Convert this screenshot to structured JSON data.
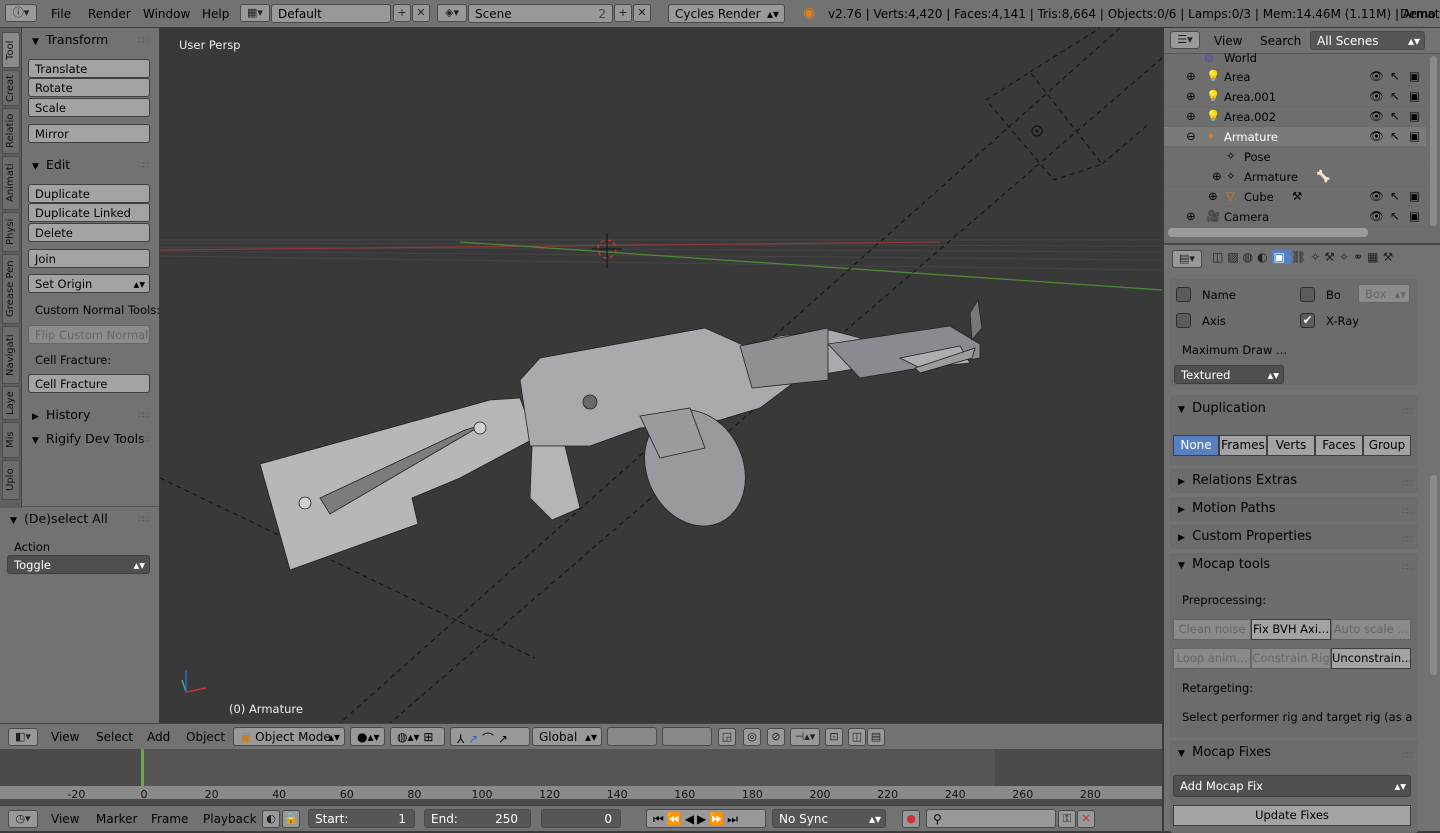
{
  "topbar": {
    "menus": [
      "File",
      "Render",
      "Window",
      "Help"
    ],
    "layout": "Default",
    "scene": "Scene",
    "scene_users": "2",
    "engine": "Cycles Render",
    "stats": "v2.76 | Verts:4,420 | Faces:4,141 | Tris:8,664 | Objects:0/6 | Lamps:0/3 | Mem:14.46M (1.11M) | Armature",
    "right_text": "Demo M"
  },
  "toolshelf": {
    "tabs": [
      "Tool",
      "Creat",
      "Relatio",
      "Animati",
      "Physi",
      "Grease Pen",
      "Navigati",
      "Laye",
      "Mis",
      "Uplo"
    ],
    "transform": {
      "title": "Transform",
      "buttons": [
        "Translate",
        "Rotate",
        "Scale"
      ],
      "mirror": "Mirror"
    },
    "edit": {
      "title": "Edit",
      "duplicate": "Duplicate",
      "duplicate_linked": "Duplicate Linked",
      "delete": "Delete",
      "join": "Join",
      "set_origin": "Set Origin",
      "custom_normal_label": "Custom Normal Tools:",
      "flip_normals": "Flip Custom Normals",
      "cell_fracture_label": "Cell Fracture:",
      "cell_fracture": "Cell Fracture"
    },
    "history": "History",
    "rigify": "Rigify Dev Tools",
    "operator": {
      "title": "(De)select All",
      "action_label": "Action",
      "action_value": "Toggle"
    }
  },
  "viewport": {
    "view_name": "User Persp",
    "object_label": "(0) Armature"
  },
  "viewhdr": {
    "menus": [
      "View",
      "Select",
      "Add",
      "Object"
    ],
    "mode": "Object Mode",
    "orientation": "Global"
  },
  "timeline": {
    "ticks": [
      "-20",
      "0",
      "20",
      "40",
      "60",
      "80",
      "100",
      "120",
      "140",
      "160",
      "180",
      "200",
      "220",
      "240",
      "260",
      "280"
    ],
    "current_frame": 0
  },
  "timehdr": {
    "menus": [
      "View",
      "Marker",
      "Frame",
      "Playback"
    ],
    "start_label": "Start:",
    "start_value": "1",
    "end_label": "End:",
    "end_value": "250",
    "frame_value": "0",
    "sync": "No Sync"
  },
  "outliner": {
    "menus": [
      "View",
      "Search"
    ],
    "scenes": "All Scenes",
    "rows": [
      {
        "name": "World"
      },
      {
        "name": "Area"
      },
      {
        "name": "Area.001"
      },
      {
        "name": "Area.002"
      },
      {
        "name": "Armature"
      },
      {
        "name": "Pose"
      },
      {
        "name": "Armature"
      },
      {
        "name": "Cube"
      },
      {
        "name": "Camera"
      }
    ]
  },
  "props": {
    "name_label": "Name",
    "bo_label": "Bo",
    "box_value": "Box",
    "axis_label": "Axis",
    "xray_label": "X-Ray",
    "max_draw_label": "Maximum Draw ...",
    "max_draw_value": "Textured",
    "duplication": {
      "title": "Duplication",
      "options": [
        "None",
        "Frames",
        "Verts",
        "Faces",
        "Group"
      ],
      "selected": "None"
    },
    "relations_extras": "Relations Extras",
    "motion_paths": "Motion Paths",
    "custom_properties": "Custom Properties",
    "mocap_tools": {
      "title": "Mocap tools",
      "preprocessing_label": "Preprocessing:",
      "row1": [
        "Clean noise",
        "Fix BVH Axi...",
        "Auto scale ..."
      ],
      "row2": [
        "Loop anim...",
        "Constrain Rig",
        "Unconstrain..."
      ],
      "retargeting_label": "Retargeting:",
      "retargeting_text": "Select performer rig and target rig (as a..."
    },
    "mocap_fixes": {
      "title": "Mocap Fixes",
      "add_fix": "Add Mocap Fix",
      "update": "Update Fixes"
    }
  }
}
